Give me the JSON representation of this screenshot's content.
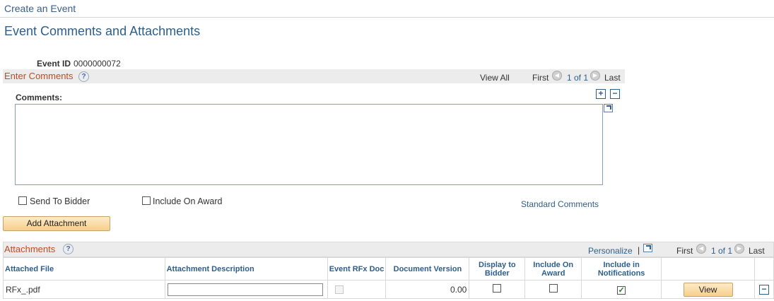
{
  "breadcrumb": "Create an Event",
  "page_title": "Event Comments and Attachments",
  "event": {
    "id_label": "Event ID",
    "id_value": "0000000072"
  },
  "comments_section": {
    "title": "Enter Comments",
    "help": "?",
    "nav": {
      "view_all": "View All",
      "first": "First",
      "count": "1 of 1",
      "last": "Last"
    },
    "comments_label": "Comments:",
    "add": "+",
    "remove": "−",
    "comments_value": "",
    "send_to_bidder_label": "Send To Bidder",
    "include_on_award_label": "Include On Award",
    "standard_comments": "Standard Comments"
  },
  "add_attachment_label": "Add Attachment",
  "attachments": {
    "title": "Attachments",
    "help": "?",
    "personalize": "Personalize",
    "separator": "|",
    "nav": {
      "first": "First",
      "count": "1 of 1",
      "last": "Last"
    },
    "columns": [
      "Attached File",
      "Attachment Description",
      "Event RFx Doc",
      "Document Version",
      "Display to Bidder",
      "Include On Award",
      "Include in Notifications"
    ],
    "rows": [
      {
        "file": "RFx_.pdf",
        "description": "",
        "version": "0.00",
        "display_to_bidder": false,
        "include_on_award": false,
        "include_in_notifications": true,
        "view_label": "View",
        "remove": "−"
      }
    ]
  }
}
